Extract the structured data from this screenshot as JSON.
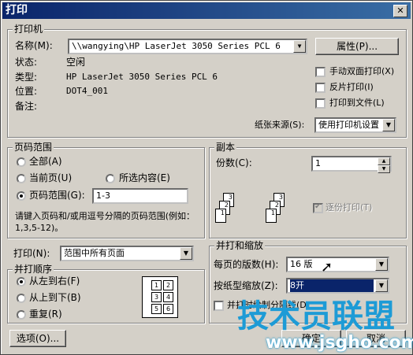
{
  "title": "打印",
  "printer": {
    "group_title": "打印机",
    "name_label": "名称(M):",
    "name_value": "\\\\wangying\\HP LaserJet 3050 Series PCL 6",
    "properties_button": "属性(P)...",
    "status_label": "状态:",
    "status_value": "空闲",
    "type_label": "类型:",
    "type_value": "HP LaserJet 3050 Series PCL 6",
    "location_label": "位置:",
    "location_value": "DOT4_001",
    "comment_label": "备注:",
    "manual_duplex": "手动双面打印(X)",
    "reverse_print": "反片打印(I)",
    "print_to_file": "打印到文件(L)",
    "paper_source_label": "纸张来源(S):",
    "paper_source_value": "使用打印机设置"
  },
  "page_range": {
    "group_title": "页码范围",
    "all": "全部(A)",
    "current": "当前页(U)",
    "selection": "所选内容(E)",
    "pages": "页码范围(G):",
    "pages_value": "1-3",
    "hint": "请键入页码和/或用逗号分隔的页码范围(例如：1,3,5-12)。"
  },
  "copies": {
    "group_title": "副本",
    "count_label": "份数(C):",
    "count_value": "1",
    "collate": "逐份打印(T)"
  },
  "print_what": {
    "label": "打印(N):",
    "value": "范围中所有页面"
  },
  "order": {
    "group_title": "并打顺序",
    "left_to_right": "从左到右(F)",
    "top_to_bottom": "从上到下(B)",
    "repeat": "重复(R)",
    "cells": [
      "1",
      "2",
      "3",
      "4",
      "5",
      "6"
    ]
  },
  "zoom": {
    "group_title": "并打和缩放",
    "pages_per_sheet_label": "每页的版数(H):",
    "pages_per_sheet_value": "16 版",
    "scale_label": "按纸型缩放(Z):",
    "scale_value": "8开",
    "draw_separator": "并打时绘制分隔线(D)"
  },
  "buttons": {
    "options": "选项(O)...",
    "ok": "确定",
    "cancel": "取消"
  },
  "watermark": {
    "brand": "技术员联盟",
    "url": "www.jsgho.com"
  }
}
